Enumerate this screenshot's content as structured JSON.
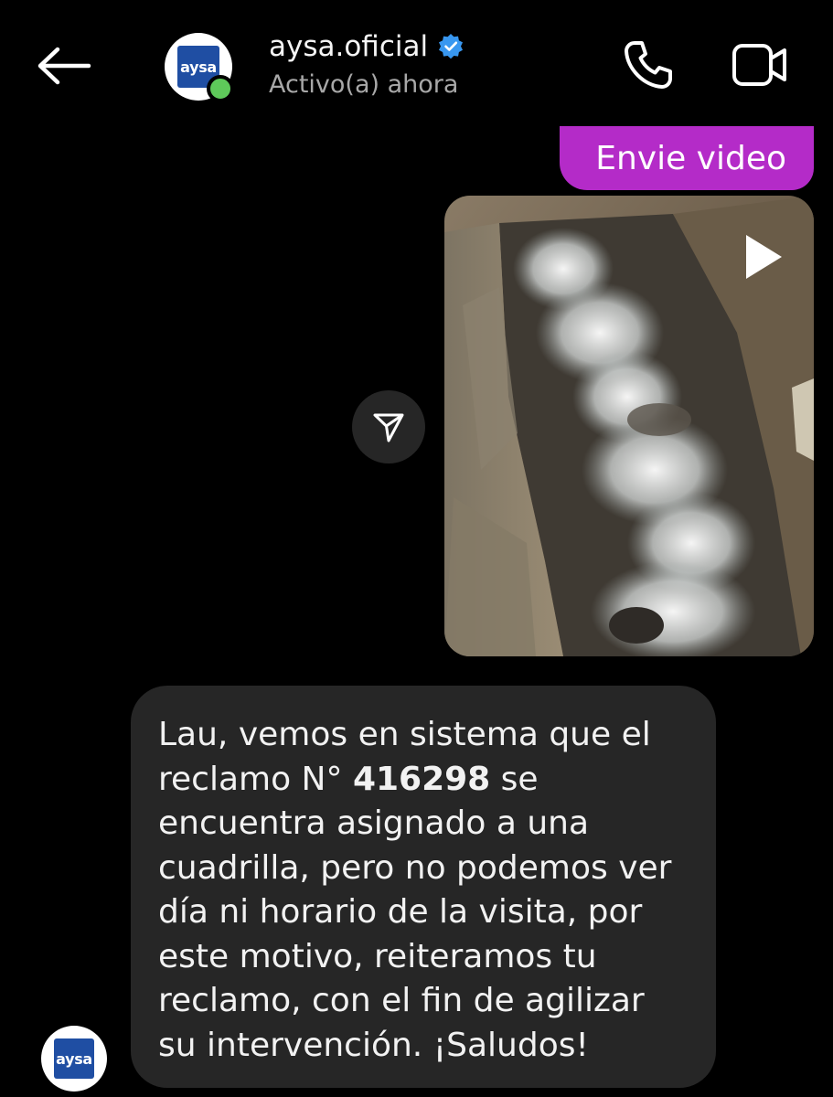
{
  "header": {
    "username": "aysa.oficial",
    "status": "Activo(a) ahora",
    "avatar_logo_text": "aysa",
    "icons": {
      "back": "back-arrow-icon",
      "verified": "verified-badge-icon",
      "call": "phone-icon",
      "video": "video-camera-icon"
    },
    "colors": {
      "verified": "#3897f0",
      "online": "#5ec95a"
    }
  },
  "messages": {
    "sent_text": "Envie video",
    "sent_color": "#b42bc8",
    "video_play_icon": "play-icon",
    "share_icon": "share-icon",
    "received": {
      "line_1_prefix": "Lau, vemos en sistema que el",
      "line_2_prefix": "reclamo N° ",
      "claim_number": "416298",
      "line_2_suffix": " se",
      "line_3": "encuentra asignado a una",
      "line_4": "cuadrilla, pero no podemos ver",
      "line_5": "día ni horario de la visita, por",
      "line_6": "este motivo, reiteramos tu",
      "line_7": "reclamo, con el fin de agilizar",
      "line_8": "su intervención. ¡Saludos!"
    },
    "received_avatar_logo_text": "aysa"
  }
}
